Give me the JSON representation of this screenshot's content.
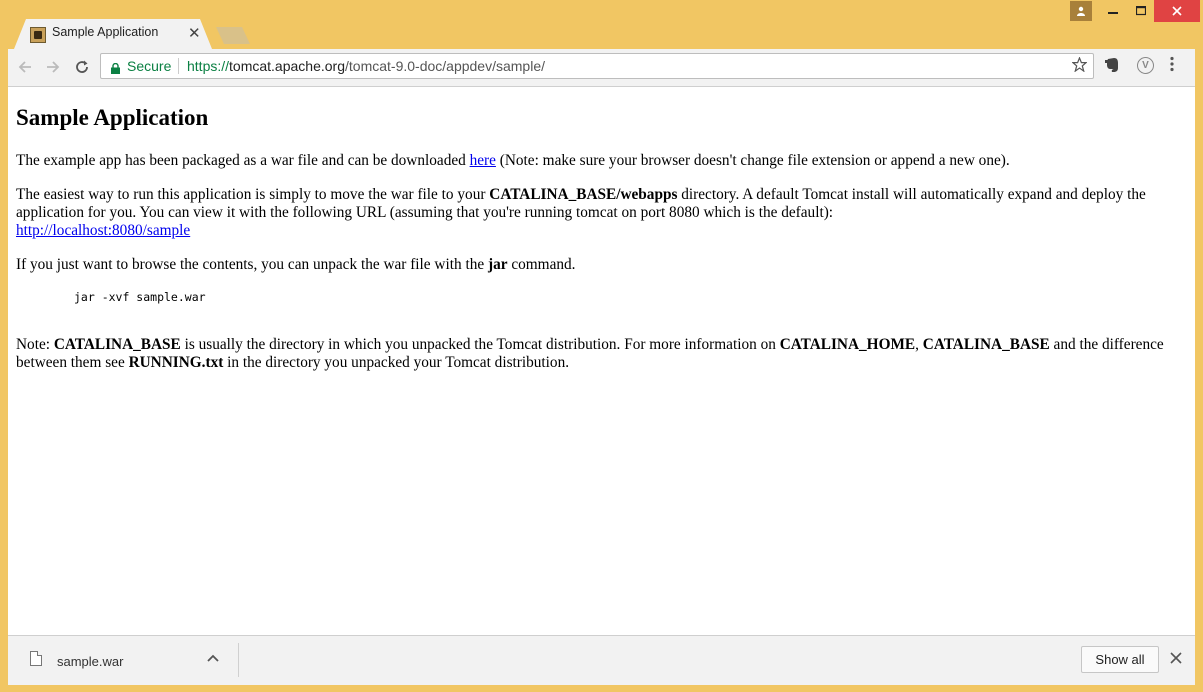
{
  "window": {
    "frame_color": "#f1c663",
    "close_color": "#e04343"
  },
  "tab": {
    "title": "Sample Application",
    "close_glyph": "✕"
  },
  "toolbar": {
    "secure_label": "Secure",
    "url_scheme": "https://",
    "url_host": "tomcat.apache.org",
    "url_path": "/tomcat-9.0-doc/appdev/sample/"
  },
  "page": {
    "heading": "Sample Application",
    "p1": {
      "before": "The example app has been packaged as a war file and can be downloaded ",
      "link": "here",
      "after": " (Note: make sure your browser doesn't change file extension or append a new one)."
    },
    "p2": {
      "t1": "The easiest way to run this application is simply to move the war file to your ",
      "b1": "CATALINA_BASE/webapps",
      "t2": " directory. A default Tomcat install will automatically expand and deploy the application for you. You can view it with the following URL (assuming that you're running tomcat on port 8080 which is the default):",
      "link": "http://localhost:8080/sample"
    },
    "p3": {
      "t1": "If you just want to browse the contents, you can unpack the war file with the ",
      "b1": "jar",
      "t2": " command."
    },
    "code": "jar -xvf sample.war",
    "p4": {
      "t1": "Note: ",
      "b1": "CATALINA_BASE",
      "t2": " is usually the directory in which you unpacked the Tomcat distribution. For more information on ",
      "b2": "CATALINA_HOME",
      "t3": ", ",
      "b3": "CATALINA_BASE",
      "t4": " and the difference between them see ",
      "b4": "RUNNING.txt",
      "t5": " in the directory you unpacked your Tomcat distribution."
    }
  },
  "download_shelf": {
    "file_name": "sample.war",
    "show_all_label": "Show all"
  },
  "icons": {
    "back": "back-arrow-icon",
    "forward": "forward-arrow-icon",
    "reload": "reload-icon",
    "lock": "lock-icon",
    "star": "star-icon",
    "evernote": "evernote-icon",
    "vimium": "v-extension-icon",
    "menu": "kebab-menu-icon"
  }
}
